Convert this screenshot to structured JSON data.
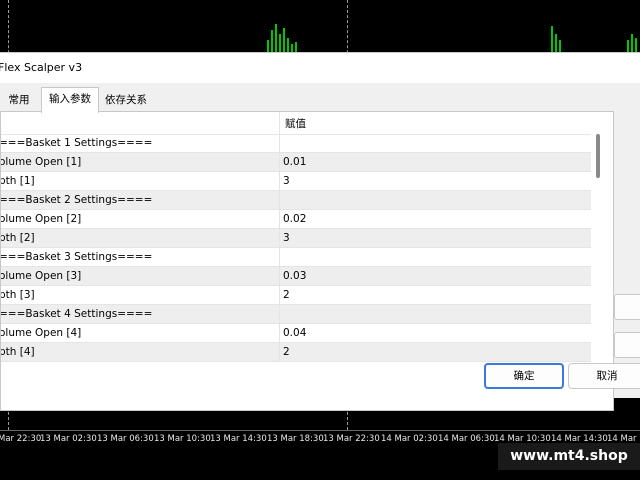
{
  "dialog": {
    "title": "Flex Scalper v3",
    "tabs": [
      {
        "label": "常用",
        "active": false
      },
      {
        "label": "输入参数",
        "active": true
      },
      {
        "label": "依存关系",
        "active": false
      }
    ],
    "column_value_header": "赋值",
    "rows": [
      {
        "name": "===Basket 1 Settings====",
        "value": ""
      },
      {
        "name": "olume Open [1]",
        "value": "0.01"
      },
      {
        "name": "pth [1]",
        "value": "3"
      },
      {
        "name": "===Basket 2 Settings====",
        "value": ""
      },
      {
        "name": "olume Open [2]",
        "value": "0.02"
      },
      {
        "name": "pth [2]",
        "value": "3"
      },
      {
        "name": "===Basket 3 Settings====",
        "value": ""
      },
      {
        "name": "olume Open [3]",
        "value": "0.03"
      },
      {
        "name": "pth [3]",
        "value": "2"
      },
      {
        "name": "===Basket 4 Settings====",
        "value": ""
      },
      {
        "name": "olume Open [4]",
        "value": "0.04"
      },
      {
        "name": "pth [4]",
        "value": "2"
      }
    ],
    "ok_label": "确定",
    "cancel_label": "取消"
  },
  "chart": {
    "time_labels": [
      "Mar 22:30",
      "13 Mar 02:30",
      "13 Mar 06:30",
      "13 Mar 10:30",
      "13 Mar 14:30",
      "13 Mar 18:30",
      "13 Mar 22:30",
      "14 Mar 02:30",
      "14 Mar 06:30",
      "14 Mar 10:30",
      "14 Mar 14:30",
      "14 Mar"
    ],
    "bar_color": "#00c800"
  },
  "watermark": "www.mt4.shop"
}
